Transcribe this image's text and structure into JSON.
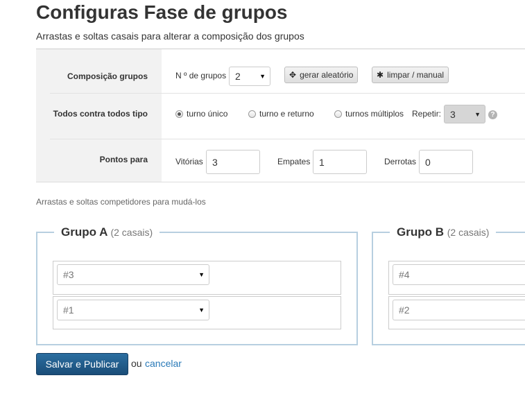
{
  "page": {
    "title": "Configuras Fase de grupos",
    "subtitle": "Arrastas e soltas casais para alterar a composição dos grupos"
  },
  "config": {
    "composition": {
      "label": "Composição grupos",
      "num_groups_label": "N º de grupos",
      "num_groups_value": "2",
      "random_button": "gerar aleatório",
      "clear_button": "limpar / manual"
    },
    "round_robin": {
      "label": "Todos contra todos tipo",
      "options": [
        "turno único",
        "turno e returno",
        "turnos múltiplos"
      ],
      "selected": "turno único",
      "repeat_label": "Repetir:",
      "repeat_value": "3",
      "help": "?"
    },
    "points": {
      "label": "Pontos para",
      "wins_label": "Vitórias",
      "wins_value": "3",
      "draws_label": "Empates",
      "draws_value": "1",
      "losses_label": "Derrotas",
      "losses_value": "0"
    }
  },
  "hint": "Arrastas e soltas competidores para mudá-los",
  "groups": [
    {
      "name": "Grupo A",
      "count": "(2 casais)",
      "slots": [
        "#3",
        "#1"
      ]
    },
    {
      "name": "Grupo B",
      "count": "(2 casais)",
      "slots": [
        "#4",
        "#2"
      ]
    }
  ],
  "actions": {
    "save": "Salvar e Publicar",
    "or": "ou",
    "cancel": "cancelar"
  }
}
